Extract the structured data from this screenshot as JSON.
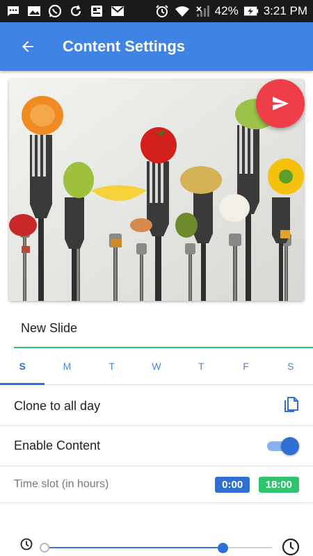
{
  "status_bar": {
    "battery_percent": "42%",
    "time": "3:21 PM",
    "left_icons": [
      "chat-icon",
      "image-icon",
      "whatsapp-icon",
      "sync-icon",
      "news-icon",
      "gmail-icon"
    ],
    "right_icons": [
      "alarm-icon",
      "wifi-icon",
      "signal-icon",
      "battery-charging-icon"
    ]
  },
  "app_bar": {
    "title": "Content Settings",
    "back_icon": "arrow-left-icon",
    "color": "#3f84e5"
  },
  "slide": {
    "image_icon": "forks-with-vegetables-image",
    "send_icon": "send-icon",
    "fab_color": "#ee3e47",
    "name": "New Slide"
  },
  "days": {
    "items": [
      "S",
      "M",
      "T",
      "W",
      "T",
      "F",
      "S"
    ],
    "active_index": 0
  },
  "settings": {
    "clone_label": "Clone to all day",
    "clone_icon": "copy-file-icon",
    "enable_label": "Enable Content",
    "enable_state": true,
    "time_slot_label": "Time slot (in hours)",
    "time_start": "0:00",
    "time_end": "18:00"
  },
  "slider": {
    "min_icon": "clock-small-icon",
    "max_icon": "clock-large-icon",
    "start_value": "0:00",
    "end_value": "18:00",
    "accent": "#2f6fd1"
  }
}
